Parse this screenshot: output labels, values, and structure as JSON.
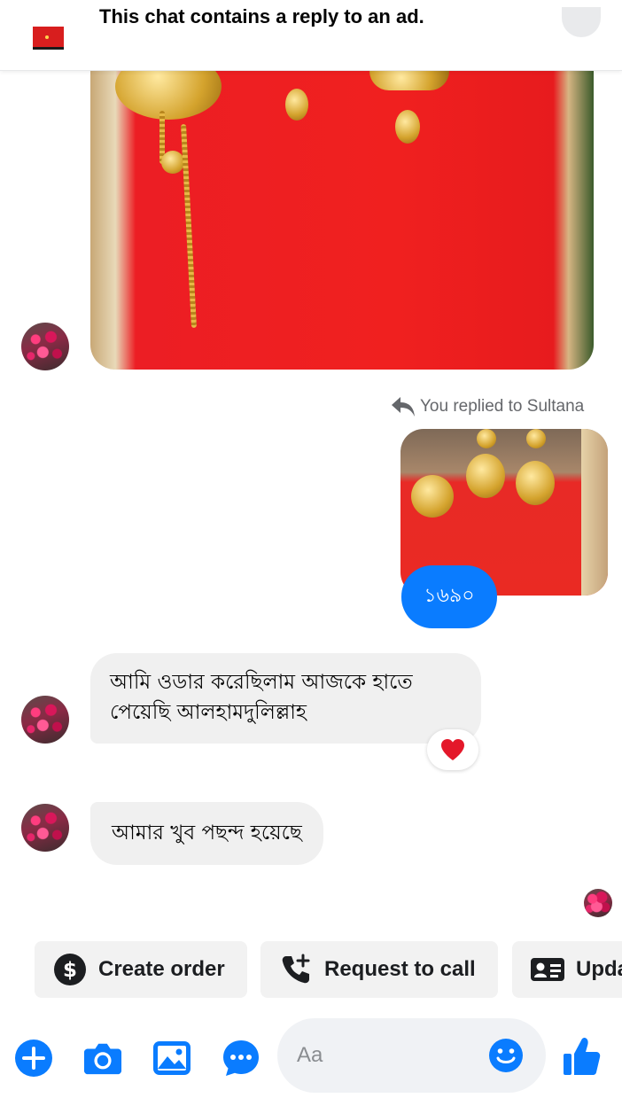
{
  "banner": {
    "text": "This chat contains a reply to an ad.",
    "thumbnail_icon": "ad-thumbnail",
    "close_icon": "close-icon"
  },
  "thread": {
    "reply_notice": "You replied to Sultana",
    "price_message": "১৬৯০",
    "message_1": "আমি  ওডার করেছিলাম আজকে হাতে পেয়েছি  আলহামদুলিল্লাহ",
    "message_1_reaction": "heart",
    "message_2": "আমার খুব পছন্দ হয়েছে"
  },
  "quick_actions": [
    {
      "label": "Create order",
      "icon": "dollar-icon"
    },
    {
      "label": "Request to call",
      "icon": "phone-add-icon"
    },
    {
      "label": "Upda",
      "icon": "id-card-icon"
    }
  ],
  "composer": {
    "placeholder": "Aa",
    "icons": [
      "plus-icon",
      "camera-icon",
      "gallery-icon",
      "chat-more-icon",
      "emoji-icon",
      "thumbs-up-icon"
    ]
  },
  "colors": {
    "accent": "#0a7cff",
    "icon_blue": "#0a7cff",
    "bubble_in": "#f0f0f0",
    "reaction_heart": "#e4182a"
  }
}
